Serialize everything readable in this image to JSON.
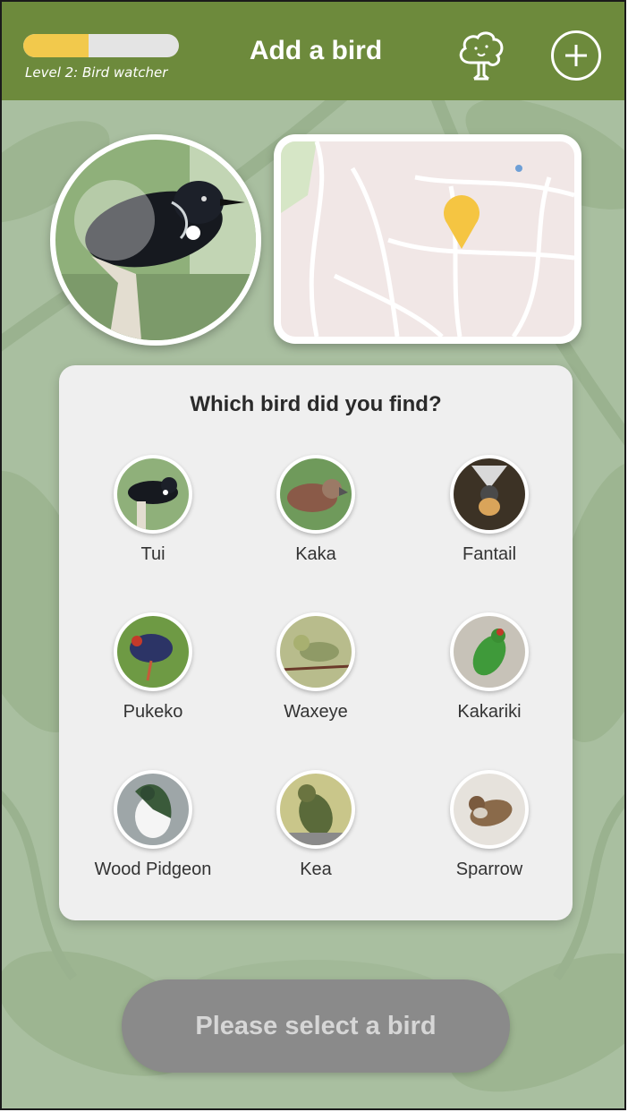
{
  "header": {
    "progress_fraction": 0.42,
    "level_label": "Level 2: Bird watcher",
    "title": "Add a bird",
    "tree_icon": "tree-icon",
    "add_icon": "plus-circle-icon"
  },
  "colors": {
    "header_bg": "#6d8a3c",
    "progress_fill": "#f2c94c",
    "map_pin": "#f5c542",
    "background": "#a9bfa0"
  },
  "question": "Which bird did you find?",
  "birds": [
    {
      "name": "Tui"
    },
    {
      "name": "Kaka"
    },
    {
      "name": "Fantail"
    },
    {
      "name": "Pukeko"
    },
    {
      "name": "Waxeye"
    },
    {
      "name": "Kakariki"
    },
    {
      "name": "Wood Pidgeon"
    },
    {
      "name": "Kea"
    },
    {
      "name": "Sparrow"
    }
  ],
  "submit_label": "Please select a bird"
}
